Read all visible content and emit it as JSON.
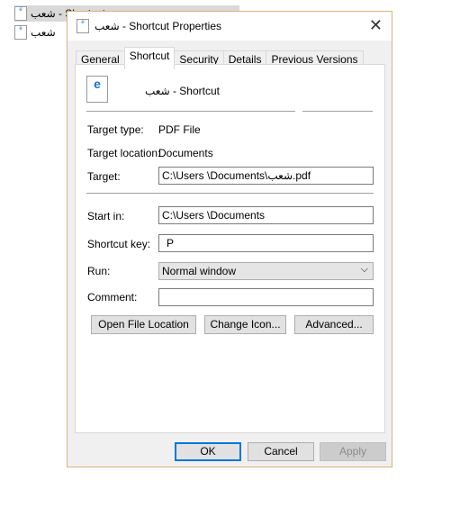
{
  "desktop": {
    "items": [
      {
        "label": "شعب - Shortcut"
      },
      {
        "label": "شعب"
      }
    ]
  },
  "dialog": {
    "title": "شعب - Shortcut Properties",
    "close_icon": "close-icon",
    "tabs": [
      {
        "label": "General"
      },
      {
        "label": "Shortcut",
        "active": true
      },
      {
        "label": "Security"
      },
      {
        "label": "Details"
      },
      {
        "label": "Previous Versions"
      }
    ],
    "name": "شعب - Shortcut",
    "fields": {
      "target_type_label": "Target type:",
      "target_type": "PDF File",
      "target_location_label": "Target location:",
      "target_location": "Documents",
      "target_label": "Target:",
      "target": "C:\\Users  \\Documents\\شعب.pdf",
      "start_in_label": "Start in:",
      "start_in": "C:\\Users  \\Documents",
      "shortcut_key_label": "Shortcut key:",
      "shortcut_key": "P",
      "run_label": "Run:",
      "run": "Normal window",
      "comment_label": "Comment:",
      "comment": ""
    },
    "buttons": {
      "open_file_location": "Open File Location",
      "change_icon": "Change Icon...",
      "advanced": "Advanced...",
      "ok": "OK",
      "cancel": "Cancel",
      "apply": "Apply"
    },
    "colors": {
      "border": "#d8b27a",
      "ok_border": "#0078d7"
    }
  }
}
